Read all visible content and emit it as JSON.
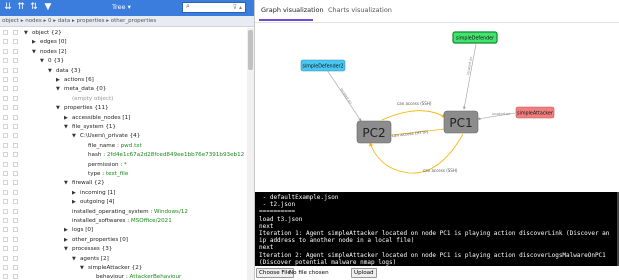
{
  "toolbar": {
    "mode_label": "Tree ▾",
    "search_placeholder": "",
    "search_controls": "⊽ ▴"
  },
  "breadcrumb": "object ▸ nodes ▸ 0 ▸ data ▸ properties ▸ other_properties",
  "tree_rows": [
    {
      "indent": 0,
      "arrow": "▼",
      "text": "object {2}",
      "style": ""
    },
    {
      "indent": 1,
      "arrow": "▶",
      "text": "edges [0]",
      "style": ""
    },
    {
      "indent": 1,
      "arrow": "▼",
      "text": "nodes [2]",
      "style": ""
    },
    {
      "indent": 2,
      "arrow": "▼",
      "text": "0 {3}",
      "style": ""
    },
    {
      "indent": 3,
      "arrow": "▼",
      "text": "data {3}",
      "style": ""
    },
    {
      "indent": 4,
      "arrow": "▶",
      "text": "actions [6]",
      "style": ""
    },
    {
      "indent": 4,
      "arrow": "▼",
      "text": "meta_data {0}",
      "style": ""
    },
    {
      "indent": 5,
      "arrow": "",
      "text": "(empty object)",
      "style": "muted"
    },
    {
      "indent": 4,
      "arrow": "▼",
      "text": "properties {11}",
      "style": ""
    },
    {
      "indent": 5,
      "arrow": "▶",
      "text": "accessible_nodes [1]",
      "style": ""
    },
    {
      "indent": 5,
      "arrow": "▼",
      "text": "file_system {1}",
      "style": ""
    },
    {
      "indent": 6,
      "arrow": "▼",
      "text": "C:\\Users\\_private {4}",
      "style": ""
    },
    {
      "indent": 7,
      "arrow": "",
      "key": "file_name : ",
      "value": "pwd.txt",
      "style": "kv"
    },
    {
      "indent": 7,
      "arrow": "",
      "key": "hash : ",
      "value": "2fd4e1c67a2d28fced849ee1bb76e7391b93eb12",
      "style": "kv"
    },
    {
      "indent": 7,
      "arrow": "",
      "key": "permission : ",
      "value": "*",
      "style": "kv"
    },
    {
      "indent": 7,
      "arrow": "",
      "key": "type : ",
      "value": "text_file",
      "style": "kv"
    },
    {
      "indent": 5,
      "arrow": "▼",
      "text": "firewall {2}",
      "style": ""
    },
    {
      "indent": 6,
      "arrow": "▶",
      "text": "incoming [1]",
      "style": ""
    },
    {
      "indent": 6,
      "arrow": "▶",
      "text": "outgoing [4]",
      "style": ""
    },
    {
      "indent": 5,
      "arrow": "",
      "key": "installed_operating_system : ",
      "value": "Windows/12",
      "style": "kv"
    },
    {
      "indent": 5,
      "arrow": "",
      "key": "installed_softwares : ",
      "value": "MSOffice/2021",
      "style": "kv"
    },
    {
      "indent": 5,
      "arrow": "▶",
      "text": "logs [0]",
      "style": ""
    },
    {
      "indent": 5,
      "arrow": "▶",
      "text": "other_properties [0]",
      "style": ""
    },
    {
      "indent": 5,
      "arrow": "▼",
      "text": "processes {3}",
      "style": ""
    },
    {
      "indent": 6,
      "arrow": "▼",
      "text": "agents [2]",
      "style": ""
    },
    {
      "indent": 7,
      "arrow": "▼",
      "text": "simpleAttacker {2}",
      "style": ""
    },
    {
      "indent": 8,
      "arrow": "",
      "key": "behaviour : ",
      "value": "AttackerBehaviour",
      "style": "kv"
    }
  ],
  "tabs": [
    {
      "label": "Graph visualization",
      "active": true
    },
    {
      "label": "Charts visualization",
      "active": false
    }
  ],
  "graph": {
    "nodes": {
      "pc1": "PC1",
      "pc2": "PC2",
      "simple_defender": "simpleDefender",
      "simple_defender2": "simpleDefender2",
      "simple_attacker": "simpleAttacker"
    },
    "edges": {
      "can_access_ssh_top": "can access (SSH)",
      "can_access_http": "can access (HTTP)",
      "can_access_ssh_bottom": "can access (SSH)",
      "located_on_defender": "located on",
      "located_on_defender2": "located on",
      "located_on_attacker": "located on"
    },
    "colors": {
      "pc_fill": "#8c8c8c",
      "defender_fill": "#44e26e",
      "defender_border": "#0e8a2e",
      "defender2_fill": "#49c7f2",
      "attacker_fill": "#f08080",
      "edge_orange": "#f5b400",
      "edge_gray": "#9a9a9a"
    }
  },
  "console_lines": [
    " - defaultExample.json",
    " - t2.json",
    "==========",
    "load t3.json",
    "next",
    "Iteration 1: Agent simpleAttacker located on node PC1 is playing action discoverLink (Discover an ip address to another node in a local file)",
    "next",
    "Iteration 2: Agent simpleAttacker located on node PC1 is playing action discoverLogsMalwareOnPC1 (Discover potential malware nmap logs)"
  ],
  "file_input": {
    "choose_label": "Choose File",
    "status": "No file chosen",
    "upload_label": "Upload"
  }
}
